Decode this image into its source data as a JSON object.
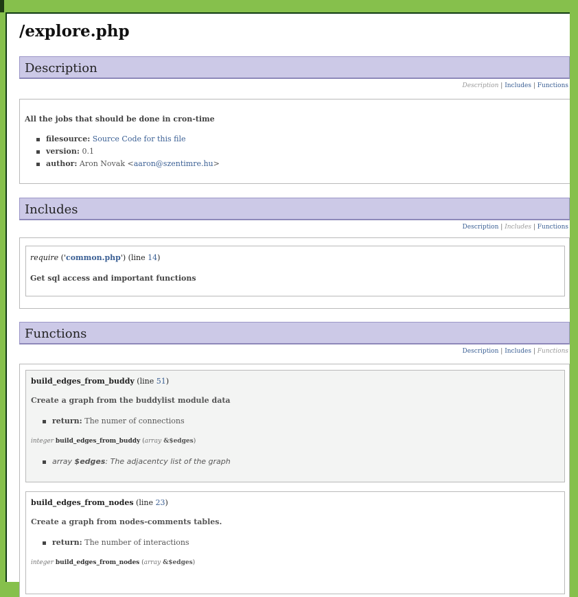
{
  "page": {
    "title": "/explore.php"
  },
  "nav": {
    "description": "Description",
    "includes": "Includes",
    "functions": "Functions",
    "separator": "|"
  },
  "description": {
    "header": "Description",
    "short": "All the jobs that should be done in cron-time",
    "tags": [
      {
        "key": "filesource:",
        "value": "Source Code for this file",
        "is_link": true
      },
      {
        "key": "version:",
        "value": "0.1"
      },
      {
        "key": "author:",
        "value_prefix": "Aron Novak <",
        "value_link": "aaron@szentimre.hu",
        "value_suffix": ">"
      }
    ]
  },
  "includes": {
    "header": "Includes",
    "item": {
      "keyword": "require",
      "open": " ('",
      "file": "common.php",
      "close": "') (line ",
      "line": "14",
      "end": ")",
      "desc": "Get sql access and important functions"
    }
  },
  "functions": {
    "header": "Functions",
    "items": [
      {
        "name": "build_edges_from_buddy",
        "line_prefix": " (line ",
        "line": "51",
        "line_suffix": ")",
        "desc": "Create a graph from the buddylist module data",
        "return_key": "return:",
        "return_val": "The numer of connections",
        "sig_type": "integer",
        "sig_name": "build_edges_from_buddy",
        "sig_open": " (",
        "sig_param_type": "array",
        "sig_param": " &$edges",
        "sig_close": ")",
        "param_type": "array",
        "param_name": "$edges",
        "param_desc": ": The adjacentcy list of the graph"
      },
      {
        "name": "build_edges_from_nodes",
        "line_prefix": " (line ",
        "line": "23",
        "line_suffix": ")",
        "desc": "Create a graph from nodes-comments tables.",
        "return_key": "return:",
        "return_val": "The number of interactions",
        "sig_type": "integer",
        "sig_name": "build_edges_from_nodes",
        "sig_open": " (",
        "sig_param_type": "array",
        "sig_param": " &$edges",
        "sig_close": ")"
      }
    ]
  }
}
